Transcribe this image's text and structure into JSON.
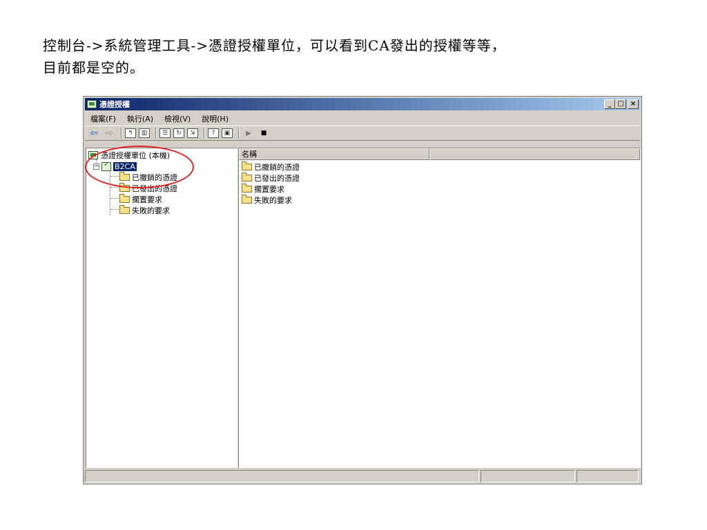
{
  "caption": {
    "line1": "控制台->系統管理工具->憑證授權單位，可以看到CA發出的授權等等，",
    "line2": "目前都是空的。"
  },
  "window": {
    "title": "憑證授權",
    "buttons": {
      "minimize": "_",
      "maximize": "□",
      "close": "×"
    }
  },
  "menu": [
    "檔案(F)",
    "執行(A)",
    "檢視(V)",
    "說明(H)"
  ],
  "tree": {
    "root_label": "憑證授權單位 (本機)",
    "ca_label": "B2CA",
    "children": [
      "已撤銷的憑證",
      "已發出的憑證",
      "擱置要求",
      "失敗的要求"
    ]
  },
  "list": {
    "columns": [
      "名稱",
      ""
    ],
    "items": [
      "已撤銷的憑證",
      "已發出的憑證",
      "擱置要求",
      "失敗的要求"
    ]
  },
  "colors": {
    "titlebar": "#0a246a",
    "highlight": "#e02020",
    "folder": "#f7e08a"
  }
}
